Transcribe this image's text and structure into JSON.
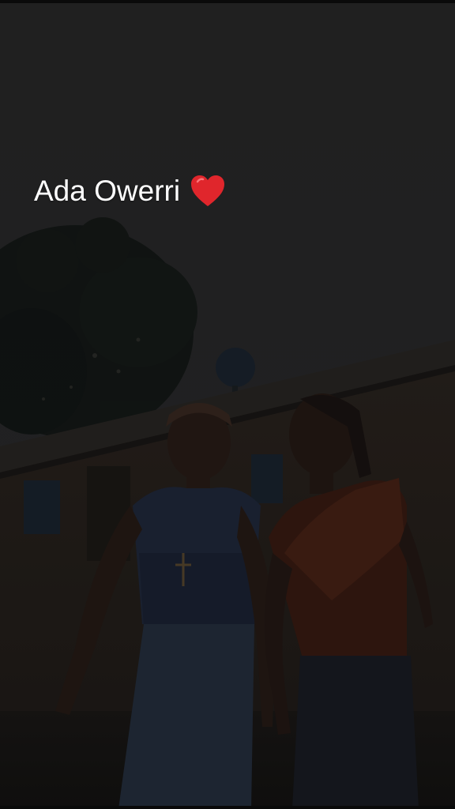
{
  "story": {
    "caption_text": "Ada Owerri",
    "caption_icon": "red-heart-icon",
    "heart_color": "#e0262c"
  }
}
